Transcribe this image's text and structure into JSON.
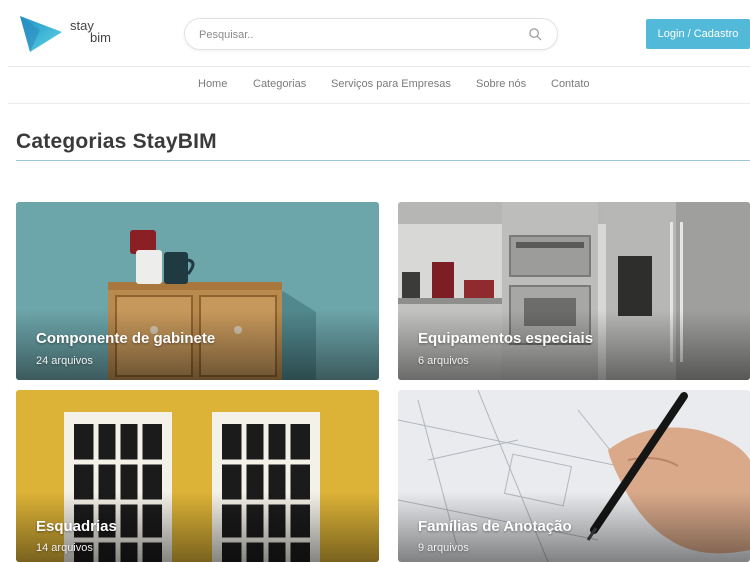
{
  "header": {
    "logo_line1": "stay",
    "logo_line2": "bim",
    "search_placeholder": "Pesquisar..",
    "login_label": "Login / Cadastro"
  },
  "nav": {
    "items": [
      "Home",
      "Categorias",
      "Serviços para Empresas",
      "Sobre nós",
      "Contato"
    ]
  },
  "page": {
    "title": "Categorias StayBIM"
  },
  "categories": [
    {
      "title": "Componente de gabinete",
      "count": "24 arquivos"
    },
    {
      "title": "Equipamentos especiais",
      "count": "6 arquivos"
    },
    {
      "title": "Esquadrias",
      "count": "14 arquivos"
    },
    {
      "title": "Famílias de Anotação",
      "count": "9 arquivos"
    }
  ],
  "colors": {
    "accent": "#52b9d8",
    "logo_gradient_start": "#2b9fd0",
    "logo_gradient_end": "#4fd4e0"
  }
}
